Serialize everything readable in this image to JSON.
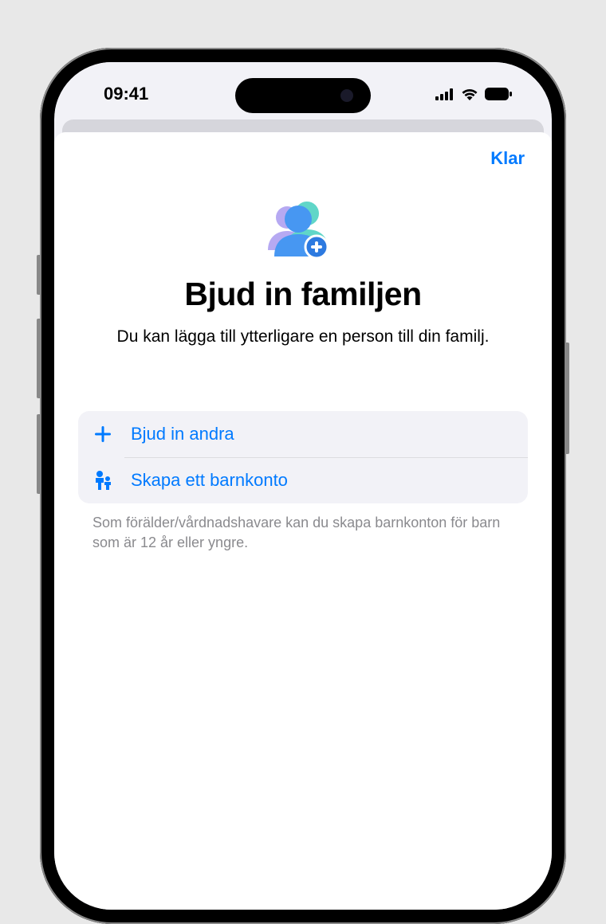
{
  "statusBar": {
    "time": "09:41"
  },
  "modal": {
    "doneLabel": "Klar",
    "title": "Bjud in familjen",
    "subtitle": "Du kan lägga till ytterligare en person till din familj."
  },
  "options": {
    "inviteOthers": "Bjud in andra",
    "createChild": "Skapa ett barnkonto"
  },
  "footerNote": "Som förälder/vårdnadshavare kan du skapa barnkonton för barn som är 12 år eller yngre."
}
